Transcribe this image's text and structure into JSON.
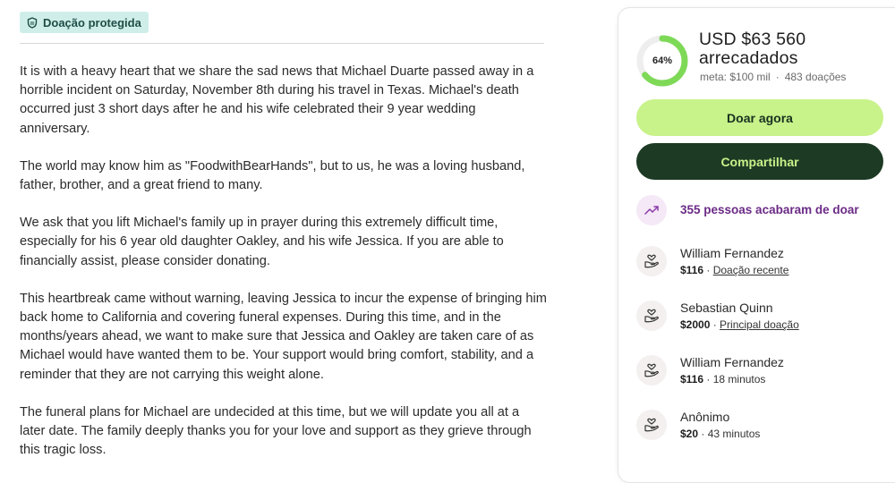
{
  "badge": {
    "label": "Doação protegida",
    "icon": "shield-icon"
  },
  "story": {
    "paragraphs": [
      "It is with a heavy heart that we share the sad news that Michael Duarte passed away in a horrible incident on Saturday, November 8th during his travel in Texas. Michael's death occurred just 3 short days after he and his wife celebrated their 9 year wedding anniversary.",
      "The world may know him as \"FoodwithBearHands\", but to us, he was a loving husband, father, brother, and a great friend to many.",
      "We ask that you lift Michael's family up in prayer during this extremely difficult time, especially for his 6 year old daughter Oakley, and his wife Jessica. If you are able to financially assist, please consider donating.",
      "This heartbreak came without warning, leaving Jessica to incur the expense of bringing him back home to California and covering funeral expenses. During this time, and in the months/years ahead, we want to make sure that Jessica and Oakley are taken care of as Michael would have wanted them to be. Your support would bring comfort, stability, and a reminder that they are not carrying this weight alone.",
      "The funeral plans for Michael are undecided at this time, but we will update you all at a later date. The family deeply thanks you for your love and support as they grieve through this tragic loss."
    ]
  },
  "progress": {
    "percent_label": "64%",
    "fraction": 0.64,
    "raised_line1": "USD $63 560",
    "raised_line2": "arrecadados",
    "goal": "meta: $100 mil",
    "donations": "483 doações",
    "ring_color": "#7ed957",
    "track_color": "#eeeeee"
  },
  "buttons": {
    "donate": "Doar agora",
    "share": "Compartilhar"
  },
  "activity": {
    "text": "355 pessoas acabaram de doar",
    "icon": "trending-up-icon",
    "color": "#6b2a86"
  },
  "donors": [
    {
      "name": "William Fernandez",
      "amount": "$116",
      "note": "Doação recente",
      "note_link": true
    },
    {
      "name": "Sebastian Quinn",
      "amount": "$2000",
      "note": "Principal doação",
      "note_link": true
    },
    {
      "name": "William Fernandez",
      "amount": "$116",
      "note": "18 minutos",
      "note_link": false
    },
    {
      "name": "Anônimo",
      "amount": "$20",
      "note": "43 minutos",
      "note_link": false
    }
  ],
  "colors": {
    "accent_green": "#c8f28a",
    "dark_green": "#1d3a24",
    "badge_bg": "#cfeeea"
  }
}
